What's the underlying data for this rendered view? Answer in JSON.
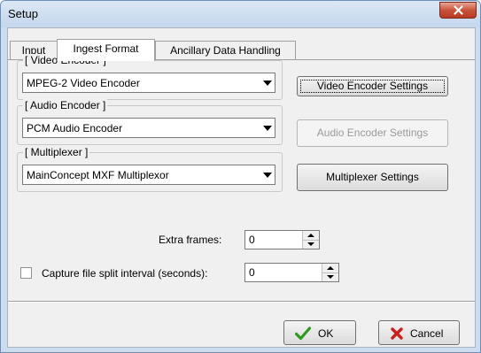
{
  "window": {
    "title": "Setup"
  },
  "tabs": [
    {
      "label": "Input"
    },
    {
      "label": "Ingest Format"
    },
    {
      "label": "Ancillary Data Handling"
    }
  ],
  "video_encoder": {
    "group_label": "[ Video Encoder ]",
    "selected": "MPEG-2 Video Encoder",
    "settings_button": "Video Encoder Settings"
  },
  "audio_encoder": {
    "group_label": "[ Audio Encoder ]",
    "selected": "PCM Audio Encoder",
    "settings_button": "Audio Encoder Settings"
  },
  "multiplexer": {
    "group_label": "[ Multiplexer ]",
    "selected": "MainConcept MXF Multiplexor",
    "settings_button": "Multiplexer Settings"
  },
  "extra_frames": {
    "label": "Extra frames:",
    "value": "0"
  },
  "capture_split": {
    "label": "Capture file split interval (seconds):",
    "value": "0",
    "checked": false
  },
  "footer": {
    "ok_label": "OK",
    "cancel_label": "Cancel"
  },
  "colors": {
    "ok_check": "#2f9a1f",
    "cancel_x": "#c8201a",
    "close_button": "#c8523a"
  }
}
